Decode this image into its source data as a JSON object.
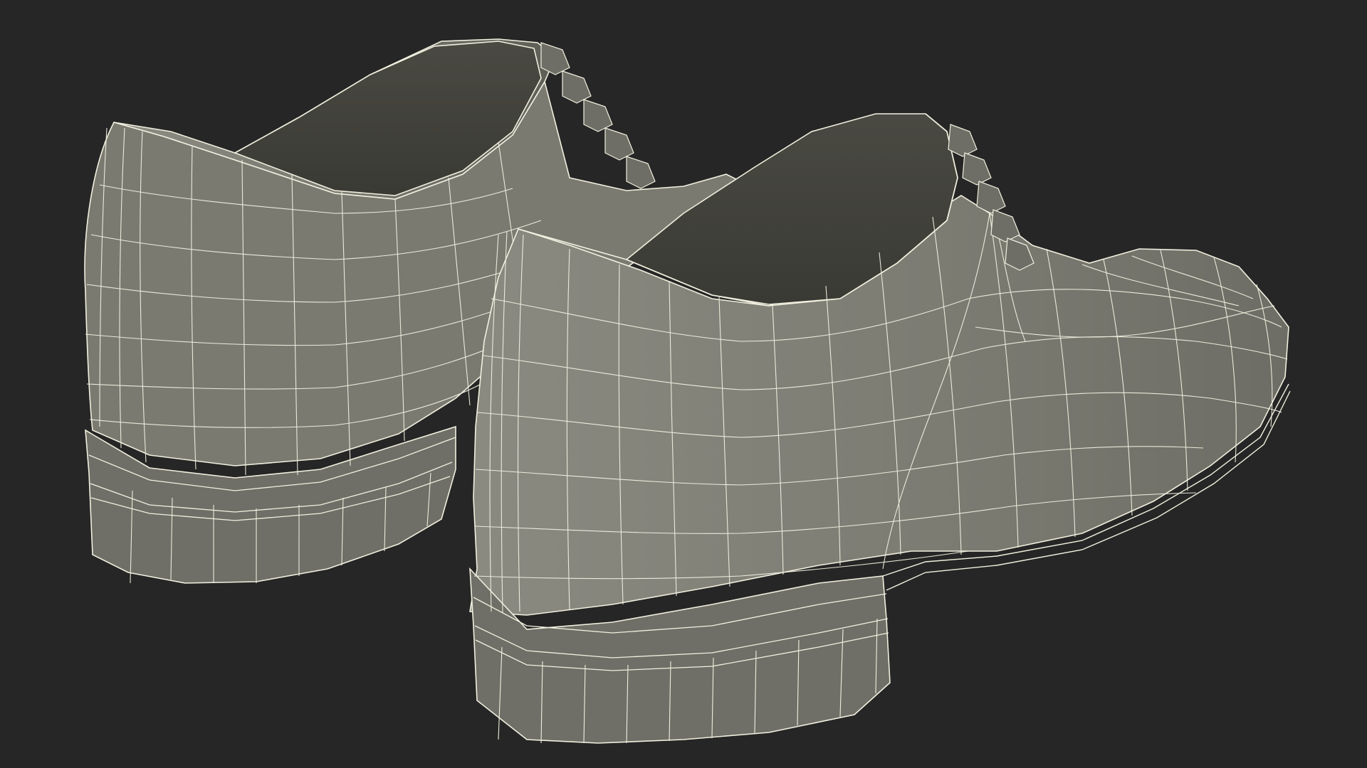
{
  "scene": {
    "background_color": "#262626",
    "surface_color": "#7a7a70",
    "surface_shadow_color": "#55554f",
    "interior_color": "#43433c",
    "wire_color": "#f1f0df",
    "objects": [
      {
        "name": "rear-shoe",
        "description_icon": "shoe-wireframe-icon"
      },
      {
        "name": "front-shoe",
        "description_icon": "shoe-wireframe-icon"
      }
    ]
  }
}
